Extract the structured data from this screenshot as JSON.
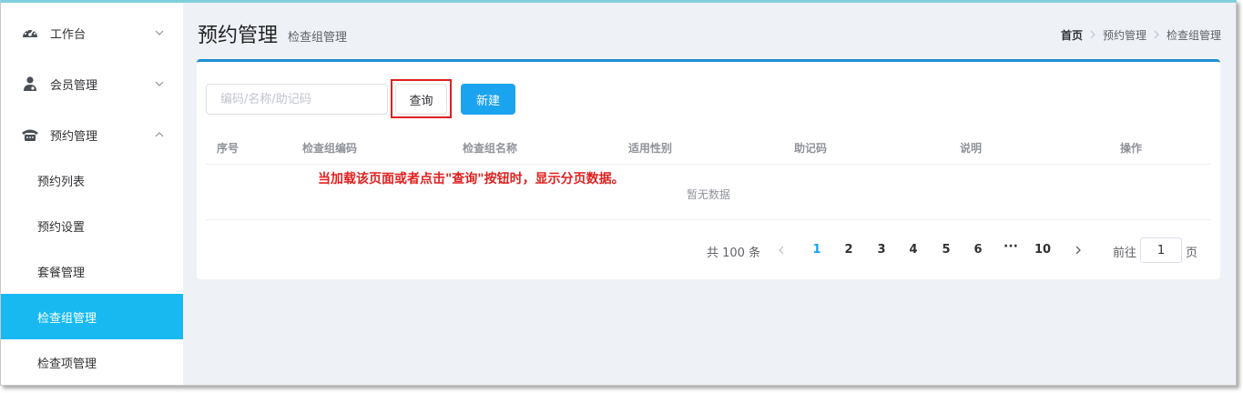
{
  "sidebar": {
    "menus": [
      {
        "label": "工作台",
        "icon": "dashboard-icon",
        "arrow": "chevron-down"
      },
      {
        "label": "会员管理",
        "icon": "user-icon",
        "arrow": "chevron-down"
      },
      {
        "label": "预约管理",
        "icon": "phone-icon",
        "arrow": "chevron-up"
      }
    ],
    "subitems": [
      {
        "label": "预约列表",
        "active": false
      },
      {
        "label": "预约设置",
        "active": false
      },
      {
        "label": "套餐管理",
        "active": false
      },
      {
        "label": "检查组管理",
        "active": true
      },
      {
        "label": "检查项管理",
        "active": false
      }
    ]
  },
  "header": {
    "title": "预约管理",
    "subtitle": "检查组管理",
    "breadcrumb": [
      "首页",
      "预约管理",
      "检查组管理"
    ]
  },
  "toolbar": {
    "search_placeholder": "编码/名称/助记码",
    "query_label": "查询",
    "new_label": "新建"
  },
  "table": {
    "columns": [
      "序号",
      "检查组编码",
      "检查组名称",
      "适用性别",
      "助记码",
      "说明",
      "操作"
    ],
    "empty_text": "暂无数据"
  },
  "annotation": "当加载该页面或者点击\"查询\"按钮时，显示分页数据。",
  "pagination": {
    "total_text": "共 100 条",
    "pages": [
      "1",
      "2",
      "3",
      "4",
      "5",
      "6"
    ],
    "ellipsis": "···",
    "last_page": "10",
    "current_page": "1",
    "goto_label": "前往",
    "goto_value": "1",
    "goto_suffix": "页"
  },
  "colors": {
    "accent": "#1aa3ef",
    "active_menu": "#18b9f0",
    "card_top_border": "#1f8ecf",
    "annotation": "#e02020"
  }
}
